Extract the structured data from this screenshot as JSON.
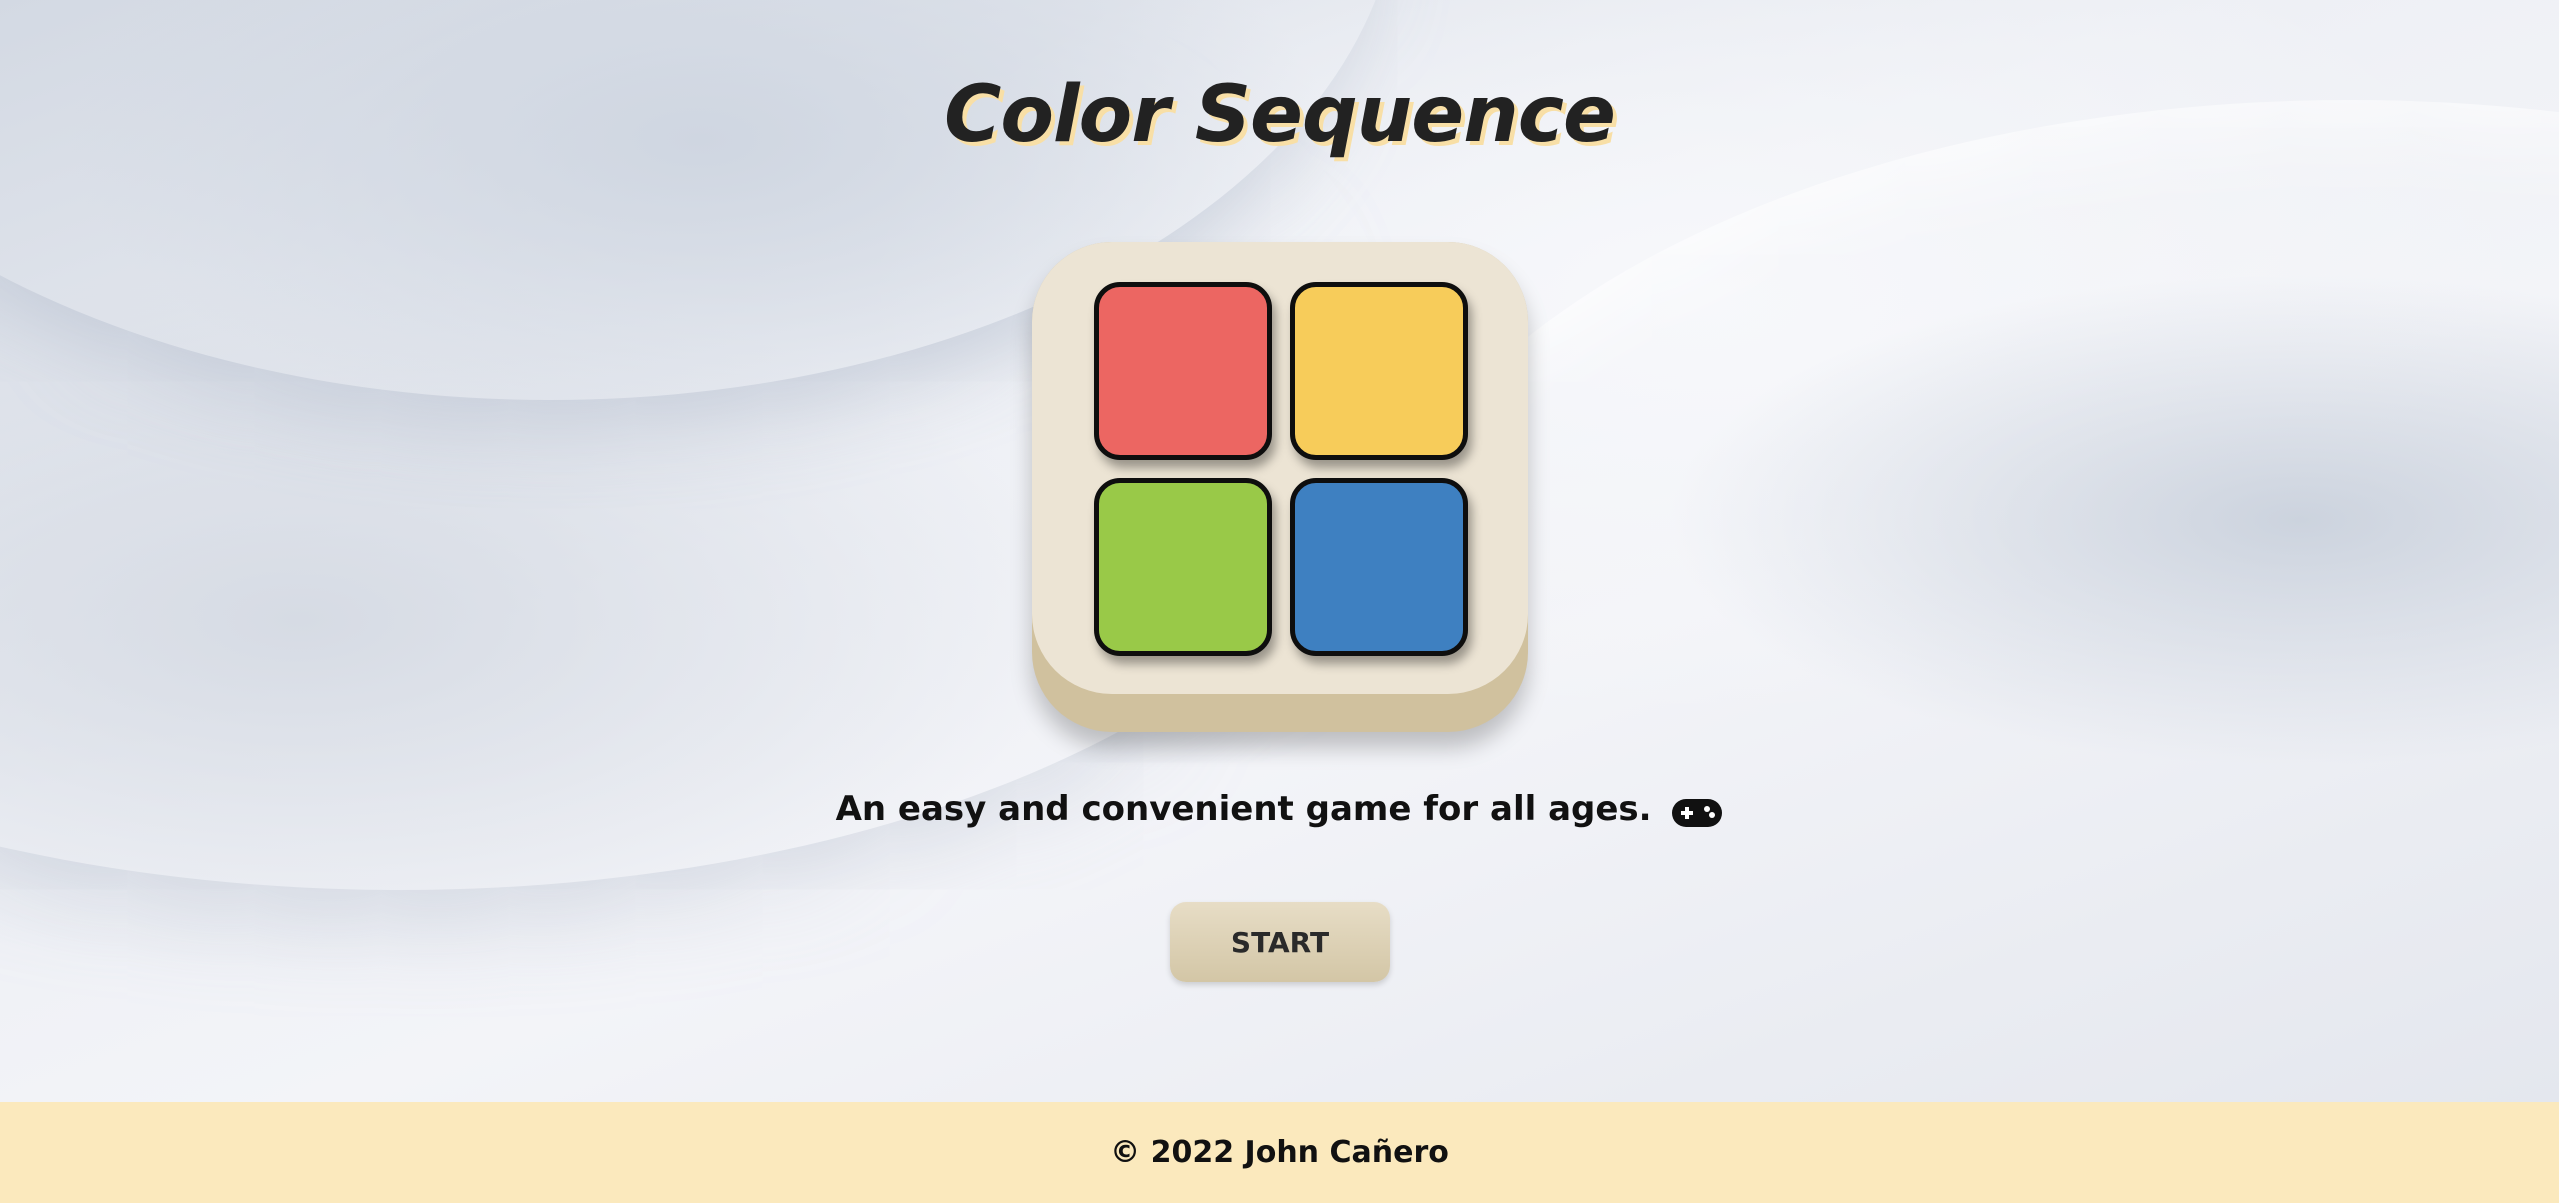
{
  "app": {
    "title": "Color Sequence",
    "tagline": "An easy and convenient game for all ages."
  },
  "board": {
    "pads": [
      {
        "name": "red",
        "color": "#ec6662"
      },
      {
        "name": "yellow",
        "color": "#f7cc5a"
      },
      {
        "name": "green",
        "color": "#99c948"
      },
      {
        "name": "blue",
        "color": "#3e80c1"
      }
    ],
    "console_color": "#ece4d4"
  },
  "controls": {
    "start_label": "START"
  },
  "footer": {
    "copyright": "© 2022 John Cañero",
    "background": "#fbe9bd"
  },
  "icons": {
    "tagline_icon": "gamepad-icon"
  }
}
